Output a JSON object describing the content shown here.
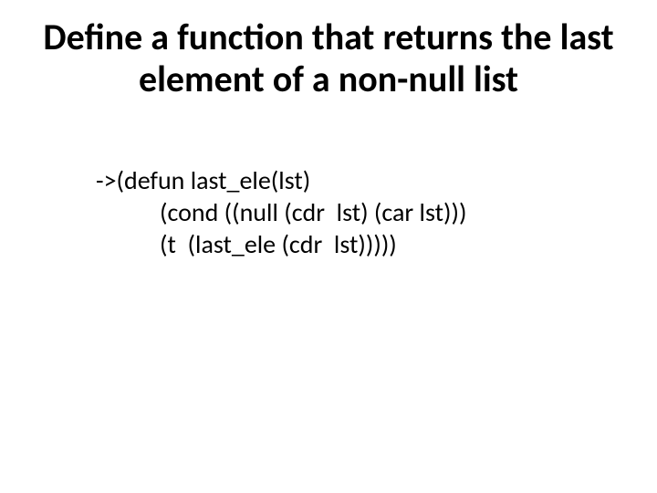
{
  "title": "Define a function that returns the last element of a non-null list",
  "code": {
    "line1": "->(defun last_ele(lst)",
    "line2": "(cond ((null (cdr  lst) (car lst)))",
    "line3": "(t  (last_ele (cdr  lst)))))"
  }
}
